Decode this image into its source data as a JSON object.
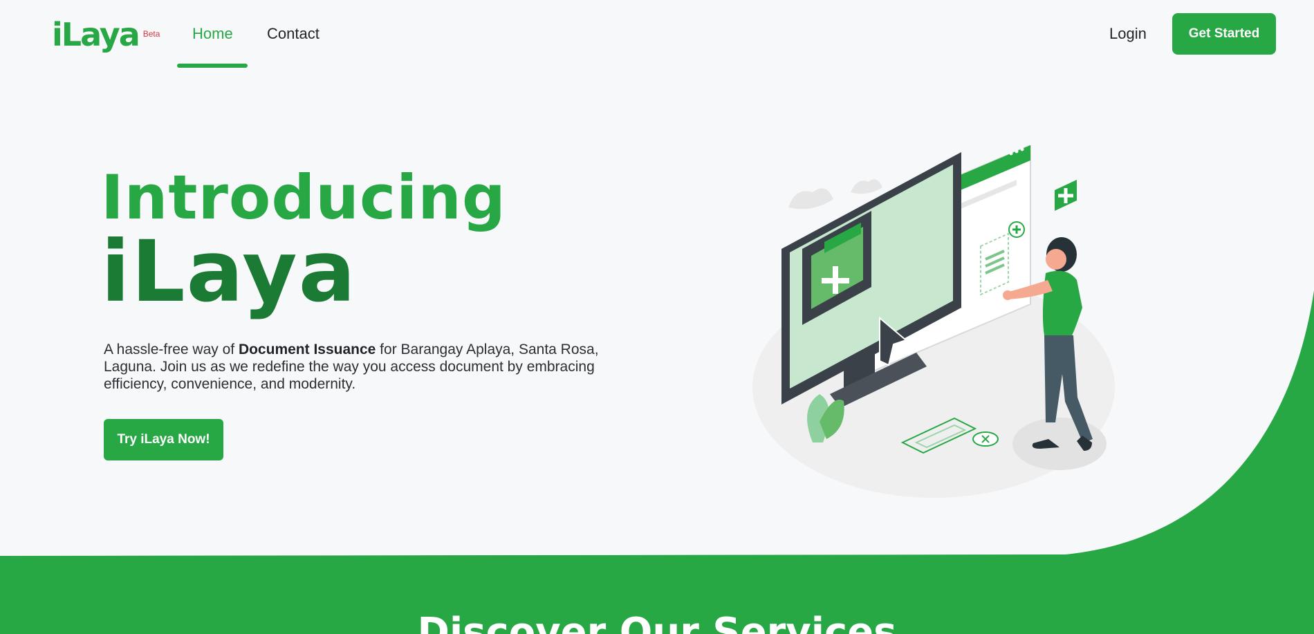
{
  "brand": {
    "name": "iLaya",
    "badge": "Beta"
  },
  "nav": {
    "home": "Home",
    "contact": "Contact",
    "login": "Login",
    "get_started": "Get Started"
  },
  "hero": {
    "title_line1": "Introducing",
    "title_line2": "iLaya",
    "desc_part1": "A hassle-free way of ",
    "desc_bold": "Document Issuance",
    "desc_part2": " for Barangay Aplaya, Santa Rosa, Laguna. Join us as we redefine the way you access document by embracing efficiency, convenience, and modernity.",
    "cta": "Try iLaya Now!"
  },
  "services": {
    "title": "Discover Our Services"
  },
  "colors": {
    "accent": "#28a745",
    "accent_dark": "#1b7a34",
    "background": "#f7f8fa",
    "badge": "#d9363e"
  },
  "icons": [
    "plus-icon",
    "cursor-icon",
    "document-icon",
    "folder-icon"
  ]
}
